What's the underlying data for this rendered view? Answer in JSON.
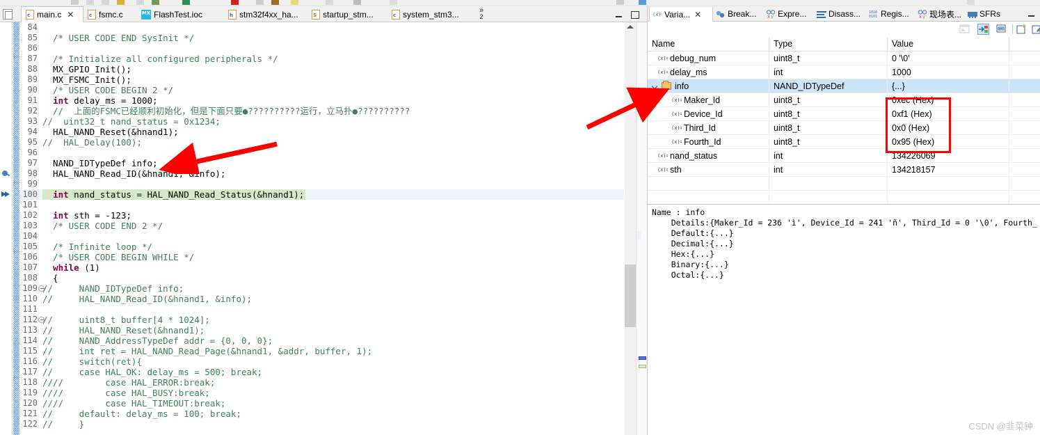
{
  "window": {
    "minimize_label": "minimize",
    "maximize_label": "maximize"
  },
  "editor": {
    "tabs": [
      {
        "label": "main.c",
        "icon": "c-file-icon",
        "badge": "c",
        "active": true,
        "closable": true
      },
      {
        "label": "fsmc.c",
        "icon": "c-file-icon",
        "badge": "c",
        "active": false,
        "closable": false
      },
      {
        "label": "FlashTest.ioc",
        "icon": "mx-file-icon",
        "badge": "MX",
        "active": false,
        "closable": false
      },
      {
        "label": "stm32f4xx_ha...",
        "icon": "h-file-icon",
        "badge": "h",
        "active": false,
        "closable": false
      },
      {
        "label": "startup_stm...",
        "icon": "s-file-icon",
        "badge": "S",
        "active": false,
        "closable": false
      },
      {
        "label": "system_stm3...",
        "icon": "c-file-icon",
        "badge": "c",
        "active": false,
        "closable": false
      }
    ],
    "overflow_chevron": "»",
    "overflow_count": "2",
    "close_glyph": "✕",
    "first_line_number": 84,
    "highlight_line": 100,
    "lines": [
      {
        "n": 84,
        "text": ""
      },
      {
        "n": 85,
        "text": "  /* USER CODE END SysInit */",
        "cls": "cm"
      },
      {
        "n": 86,
        "text": ""
      },
      {
        "n": 87,
        "text": "  /* Initialize all configured peripherals */",
        "cls": "cm"
      },
      {
        "n": 88,
        "text": "  MX_GPIO_Init();"
      },
      {
        "n": 89,
        "text": "  MX_FSMC_Init();"
      },
      {
        "n": 90,
        "text": "  /* USER CODE BEGIN 2 */",
        "cls": "cm"
      },
      {
        "n": 91,
        "text": "  int delay_ms = 1000;",
        "kw": "int"
      },
      {
        "n": 92,
        "text": "  //  上面的FSMC已经顺利初始化，但是下面只要●??????????运行，立马扑●??????????",
        "cls": "cm"
      },
      {
        "n": 93,
        "text": "//  uint32_t nand_status = 0x1234;",
        "cls": "cm"
      },
      {
        "n": 94,
        "text": "  HAL_NAND_Reset(&hnand1);"
      },
      {
        "n": 95,
        "text": "//  HAL_Delay(100);",
        "cls": "cm"
      },
      {
        "n": 96,
        "text": ""
      },
      {
        "n": 97,
        "text": "  NAND_IDTypeDef info;"
      },
      {
        "n": 98,
        "text": "  HAL_NAND_Read_ID(&hnand1, &info);",
        "glyph": "breakpoint"
      },
      {
        "n": 99,
        "text": ""
      },
      {
        "n": 100,
        "text": "  int nand_status = HAL_NAND_Read_Status(&hnand1);",
        "kw": "int",
        "glyph": "instruction-pointer",
        "highlight": true
      },
      {
        "n": 101,
        "text": ""
      },
      {
        "n": 102,
        "text": "  int sth = -123;",
        "kw": "int"
      },
      {
        "n": 103,
        "text": "  /* USER CODE END 2 */",
        "cls": "cm"
      },
      {
        "n": 104,
        "text": ""
      },
      {
        "n": 105,
        "text": "  /* Infinite loop */",
        "cls": "cm"
      },
      {
        "n": 106,
        "text": "  /* USER CODE BEGIN WHILE */",
        "cls": "cm"
      },
      {
        "n": 107,
        "text": "  while (1)",
        "kw": "while"
      },
      {
        "n": 108,
        "text": "  {"
      },
      {
        "n": 109,
        "text": "//     NAND_IDTypeDef info;",
        "cls": "cm",
        "fold": true
      },
      {
        "n": 110,
        "text": "//     HAL_NAND_Read_ID(&hnand1, &info);",
        "cls": "cm"
      },
      {
        "n": 111,
        "text": ""
      },
      {
        "n": 112,
        "text": "//     uint8_t buffer[4 * 1024];",
        "cls": "cm",
        "fold": true
      },
      {
        "n": 113,
        "text": "//     HAL_NAND_Reset(&hnand1);",
        "cls": "cm"
      },
      {
        "n": 114,
        "text": "//     NAND_AddressTypeDef addr = {0, 0, 0};",
        "cls": "cm"
      },
      {
        "n": 115,
        "text": "//     int ret = HAL_NAND_Read_Page(&hnand1, &addr, buffer, 1);",
        "cls": "cm"
      },
      {
        "n": 116,
        "text": "//     switch(ret){",
        "cls": "cm"
      },
      {
        "n": 117,
        "text": "//     case HAL_OK: delay_ms = 500; break;",
        "cls": "cm"
      },
      {
        "n": 118,
        "text": "////        case HAL_ERROR:break;",
        "cls": "cm"
      },
      {
        "n": 119,
        "text": "////        case HAL_BUSY:break;",
        "cls": "cm"
      },
      {
        "n": 120,
        "text": "////        case HAL_TIMEOUT:break;",
        "cls": "cm"
      },
      {
        "n": 121,
        "text": "//     default: delay_ms = 100; break;",
        "cls": "cm"
      },
      {
        "n": 122,
        "text": "//     }",
        "cls": "cm"
      }
    ]
  },
  "debug_panel": {
    "tabs": [
      {
        "label": "Varia...",
        "icon": "variables-icon",
        "active": true,
        "closable": true
      },
      {
        "label": "Break...",
        "icon": "breakpoints-icon",
        "active": false,
        "closable": false
      },
      {
        "label": "Expre...",
        "icon": "expressions-icon",
        "active": false,
        "closable": false
      },
      {
        "label": "Disass...",
        "icon": "disassembly-icon",
        "active": false,
        "closable": false
      },
      {
        "label": "Regis...",
        "icon": "registers-icon",
        "active": false,
        "closable": false
      },
      {
        "label": "现场表...",
        "icon": "live-expressions-icon",
        "active": false,
        "closable": false
      },
      {
        "label": "SFRs",
        "icon": "sfrs-icon",
        "active": false,
        "closable": false
      }
    ],
    "close_glyph": "✕",
    "toolbar": [
      {
        "name": "collapse-all-icon",
        "selected": false,
        "enabled": false
      },
      {
        "name": "show-type-names-icon",
        "selected": true,
        "enabled": true
      },
      {
        "name": "show-logical-structure-icon",
        "selected": false,
        "enabled": true
      },
      {
        "name": "new-expression-icon",
        "selected": false,
        "enabled": true
      },
      {
        "name": "edit-watch-icon",
        "selected": false,
        "enabled": true
      }
    ],
    "table": {
      "columns": [
        "Name",
        "Type",
        "Value"
      ],
      "rows": [
        {
          "name": "debug_num",
          "type": "uint8_t",
          "value": "0 '\\0'",
          "indent": 1,
          "icon": "variable-icon",
          "expandable": false,
          "selected": false
        },
        {
          "name": "delay_ms",
          "type": "int",
          "value": "1000",
          "indent": 1,
          "icon": "variable-icon",
          "expandable": false,
          "selected": false
        },
        {
          "name": "info",
          "type": "NAND_IDTypeDef",
          "value": "{...}",
          "indent": 1,
          "icon": "struct-icon",
          "expandable": true,
          "expanded": true,
          "selected": true
        },
        {
          "name": "Maker_Id",
          "type": "uint8_t",
          "value": "0xec (Hex)",
          "indent": 2,
          "icon": "variable-icon",
          "expandable": false,
          "selected": false,
          "boxed": true
        },
        {
          "name": "Device_Id",
          "type": "uint8_t",
          "value": "0xf1 (Hex)",
          "indent": 2,
          "icon": "variable-icon",
          "expandable": false,
          "selected": false,
          "boxed": true
        },
        {
          "name": "Third_Id",
          "type": "uint8_t",
          "value": "0x0 (Hex)",
          "indent": 2,
          "icon": "variable-icon",
          "expandable": false,
          "selected": false,
          "boxed": true
        },
        {
          "name": "Fourth_Id",
          "type": "uint8_t",
          "value": "0x95 (Hex)",
          "indent": 2,
          "icon": "variable-icon",
          "expandable": false,
          "selected": false,
          "boxed": true
        },
        {
          "name": "nand_status",
          "type": "int",
          "value": "134226069",
          "indent": 1,
          "icon": "variable-icon",
          "expandable": false,
          "selected": false
        },
        {
          "name": "sth",
          "type": "int",
          "value": "134218157",
          "indent": 1,
          "icon": "variable-icon",
          "expandable": false,
          "selected": false
        },
        {
          "name": "",
          "type": "",
          "value": "",
          "indent": 1,
          "icon": "",
          "expandable": false,
          "selected": false
        },
        {
          "name": "",
          "type": "",
          "value": "",
          "indent": 1,
          "icon": "",
          "expandable": false,
          "selected": false
        }
      ]
    },
    "detail": "Name : info\n    Details:{Maker_Id = 236 'ì', Device_Id = 241 'ñ', Third_Id = 0 '\\0', Fourth_\n    Default:{...}\n    Decimal:{...}\n    Hex:{...}\n    Binary:{...}\n    Octal:{...}"
  },
  "annotations": {
    "arrow_color": "#ff0000",
    "box_color": "#ff0000",
    "arrow_to_info_declaration": "points at NAND_IDTypeDef info; on line 97",
    "arrow_to_info_row": "points at info row in variables table",
    "boxed_values": [
      "0xec (Hex)",
      "0xf1 (Hex)",
      "0x0 (Hex)",
      "0x95 (Hex)"
    ]
  },
  "watermark": "CSDN @韭菜钟",
  "colors": {
    "highlight_line_bg": "#d6e9c6",
    "selection_row_bg": "#cde4f7",
    "comment_green": "#3f7f5f",
    "keyword_purple": "#7f0055",
    "accent_red": "#ff0000"
  }
}
